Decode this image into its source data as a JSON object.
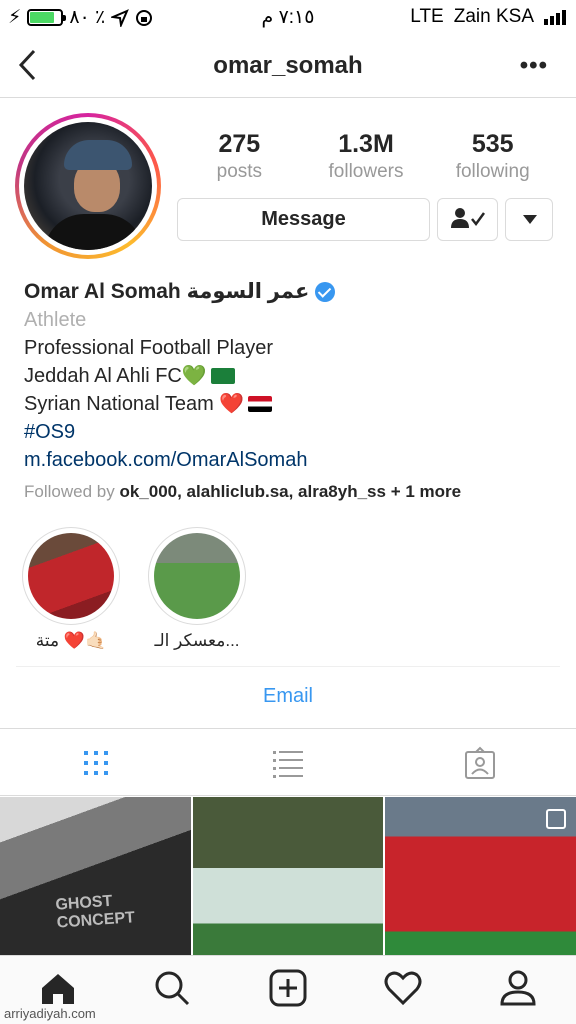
{
  "status_bar": {
    "battery": "٨٠ ٪",
    "time": "٧:١٥ م",
    "network": "LTE",
    "carrier": "Zain KSA",
    "battery_level": 0.8
  },
  "nav": {
    "back_icon": "chevron-left-icon",
    "username": "omar_somah",
    "more_label": "•••"
  },
  "stats": [
    {
      "value": "275",
      "label": "posts"
    },
    {
      "value": "1.3M",
      "label": "followers"
    },
    {
      "value": "535",
      "label": "following"
    }
  ],
  "actions": {
    "message_label": "Message",
    "following_icon": "person-check-icon",
    "dropdown_icon": "triangle-down-icon"
  },
  "bio": {
    "name": "Omar Al Somah عمر السومة",
    "category": "Athlete",
    "line1": "Professional Football Player",
    "line2": "Jeddah Al Ahli FC💚",
    "line3": "Syrian National Team ❤️",
    "hashtag": "#OS9",
    "link": "m.facebook.com/OmarAlSomah",
    "followed_by_prefix": "Followed by",
    "followed_by_users": "ok_000, alahliclub.sa, alra8yh_ss",
    "followed_by_more": "+ 1 more"
  },
  "highlights": [
    {
      "label": "متة ❤️🤙🏻"
    },
    {
      "label": "معسكر الـ..."
    }
  ],
  "email_label": "Email",
  "tabs": [
    "grid-icon",
    "list-icon",
    "tagged-icon"
  ],
  "bottom_nav": [
    "home-icon",
    "search-icon",
    "add-icon",
    "heart-icon",
    "profile-icon"
  ],
  "grid_posts": [
    {
      "caption": "GHOST CONCEPT"
    },
    {
      "caption": ""
    },
    {
      "caption": ""
    }
  ],
  "watermark": "arriyadiyah.com",
  "colors": {
    "link": "#003569",
    "accent": "#3897f0",
    "muted": "#999999"
  }
}
